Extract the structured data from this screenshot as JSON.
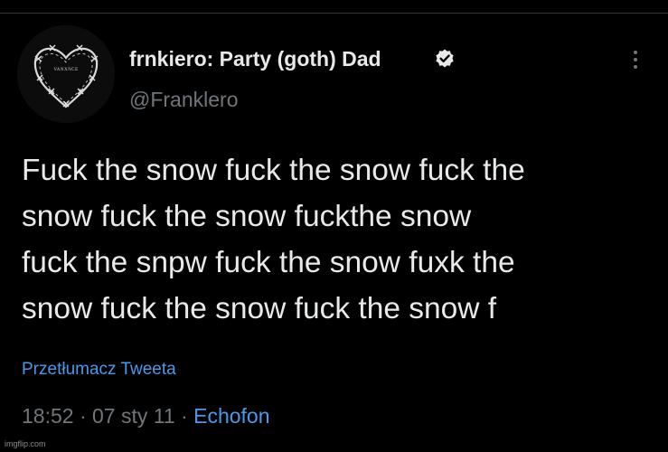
{
  "user": {
    "display_name": "frnkiero: Party (goth) Dad",
    "handle": "@Franklero",
    "avatar_text": "VANXNCE",
    "verified": true
  },
  "tweet": {
    "lines": [
      "Fuck the snow fuck the snow fuck the",
      "snow fuck the snow fuckthe snow",
      "fuck the snpw fuck the snow fuxk the",
      "snow fuck the snow fuck the snow f"
    ],
    "translate_label": "Przetłumacz Tweeta",
    "time": "18:52",
    "sep1": " · ",
    "date": "07 sty 11",
    "sep2": " · ",
    "source": "Echofon"
  },
  "watermark": "imgflip.com",
  "icons": {
    "verified": "verified-badge-icon",
    "more": "more-options-icon"
  },
  "colors": {
    "background": "#000000",
    "text": "#e7e9ea",
    "secondary": "#71767b",
    "link": "#4a99e9"
  }
}
